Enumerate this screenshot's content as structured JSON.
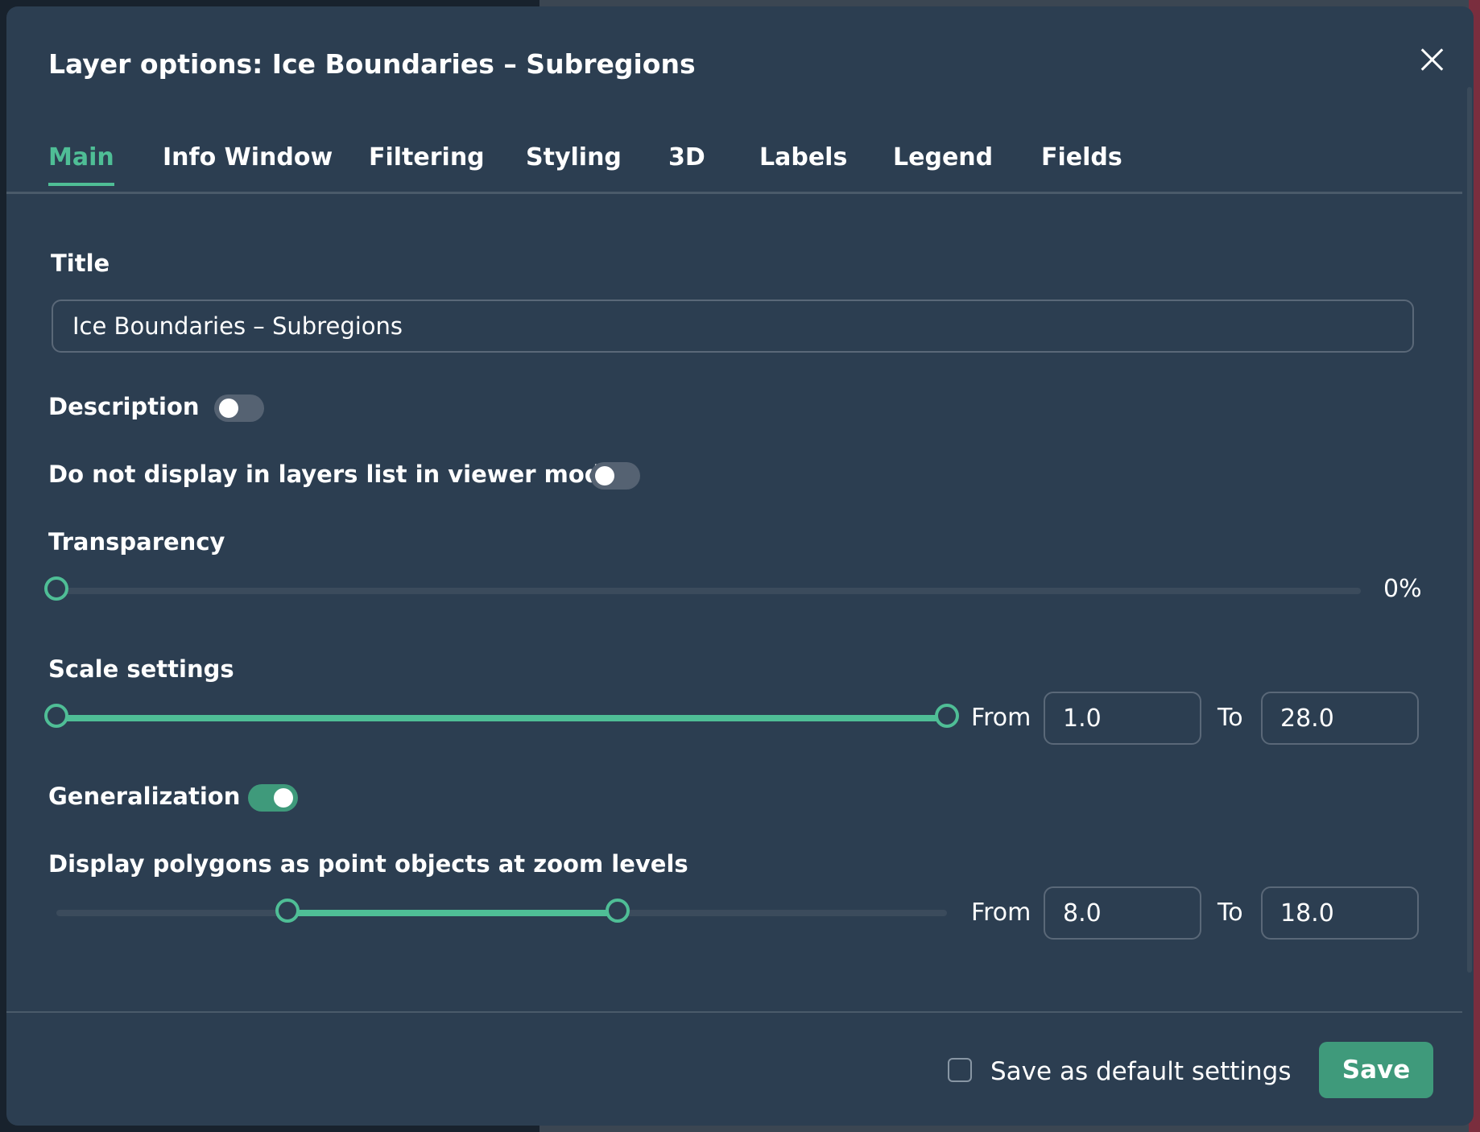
{
  "dialog": {
    "title": "Layer options: Ice Boundaries – Subregions"
  },
  "tabs": [
    {
      "label": "Main",
      "active": true
    },
    {
      "label": "Info Window"
    },
    {
      "label": "Filtering"
    },
    {
      "label": "Styling"
    },
    {
      "label": "3D"
    },
    {
      "label": "Labels"
    },
    {
      "label": "Legend"
    },
    {
      "label": "Fields"
    }
  ],
  "main": {
    "title_label": "Title",
    "title_value": "Ice Boundaries – Subregions",
    "description_label": "Description",
    "description_on": false,
    "hide_in_list_label": "Do not display in layers list in viewer mode",
    "hide_in_list_on": false,
    "transparency_label": "Transparency",
    "transparency_value": "0%",
    "scale_label": "Scale settings",
    "scale_from_label": "From",
    "scale_from": "1.0",
    "scale_to_label": "To",
    "scale_to": "28.0",
    "generalization_label": "Generalization",
    "generalization_on": true,
    "points_label": "Display polygons as point objects at zoom levels",
    "points_from_label": "From",
    "points_from": "8.0",
    "points_to_label": "To",
    "points_to": "18.0"
  },
  "footer": {
    "save_default_label": "Save as default settings",
    "save_default_checked": false,
    "save_label": "Save"
  },
  "colors": {
    "accent": "#4fbe96",
    "dialog_bg": "#2c3e51",
    "save_button": "#3f9a7b"
  }
}
